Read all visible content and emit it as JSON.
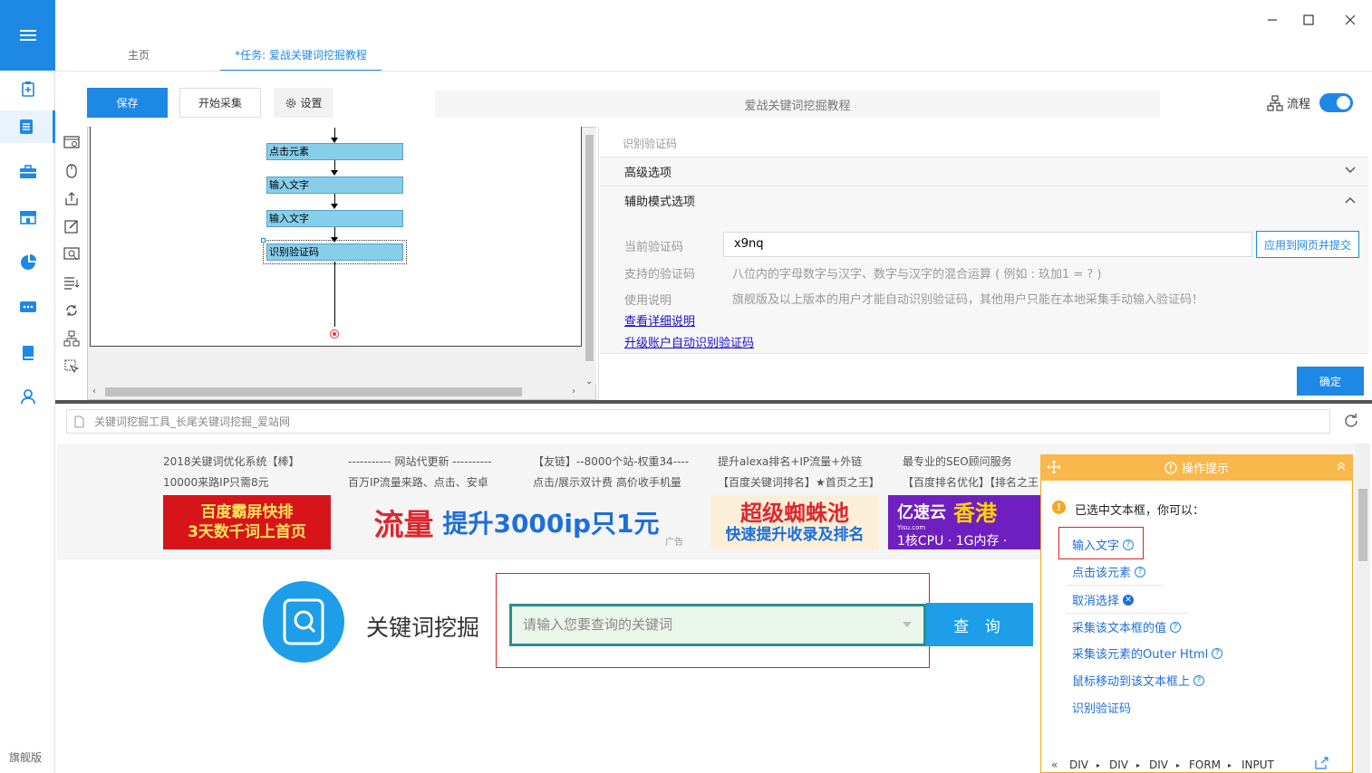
{
  "sidebar": {
    "edition": "旗舰版"
  },
  "tabs": {
    "home": "主页",
    "task": "*任务: 爱战关键词挖掘教程"
  },
  "toolbar": {
    "save": "保存",
    "start": "开始采集",
    "settings": "设置",
    "task_title": "爱战关键词挖掘教程",
    "flow": "流程"
  },
  "workflow": {
    "nodes": [
      "点击元素",
      "输入文字",
      "输入文字",
      "识别验证码"
    ]
  },
  "panel": {
    "title": "识别验证码",
    "advanced": "高级选项",
    "assist": "辅助模式选项",
    "current_label": "当前验证码",
    "current_value": "x9nq",
    "apply_button": "应用到网页并提交",
    "supported_label": "支持的验证码",
    "supported_value": "八位内的字母数字与汉字、数字与汉字的混合运算 ( 例如 : 玖加1 = ? )",
    "usage_label": "使用说明",
    "usage_value": "旗舰版及以上版本的用户才能自动识别验证码，其他用户只能在本地采集手动输入验证码！",
    "link_detail": "查看详细说明",
    "link_upgrade": "升级账户自动识别验证码",
    "ok": "确定"
  },
  "browser": {
    "url": "关键词挖掘工具_长尾关键词挖掘_爱站网"
  },
  "ads": {
    "row1": [
      "2018关键词优化系统【棒】",
      "----------- 网站代更新 ----------",
      "【友链】--8000个站-权重34----",
      "提升alexa排名+IP流量+外链",
      "最专业的SEO顾问服务"
    ],
    "row2": [
      "10000来路IP只需8元",
      "百万IP流量来路、点击、安卓",
      "点击/展示双计费 高价收手机量",
      "【百度关键词排名】★首页之王】",
      "【百度排名优化】【排名之王"
    ],
    "banner1_line1": "百度霸屏快排",
    "banner1_line2": "3天数千词上首页",
    "banner2_a": "流量",
    "banner2_b": "提升3000ip只1元",
    "banner2_tag": "广告",
    "banner3_line1": "超级蜘蛛池",
    "banner3_line2": "快速提升收录及排名",
    "banner4_brand": "亿速云",
    "banner4_brand_sub": "Yisu.com",
    "banner4_region": "香港",
    "banner4_spec": "1核CPU · 1G内存 ·"
  },
  "site": {
    "title": "关键词挖掘",
    "search_placeholder": "请输入您要查询的关键词",
    "query": "查 询"
  },
  "tips": {
    "header": "操作提示",
    "intro": "已选中文本框，你可以：",
    "actions": [
      "输入文字",
      "点击该元素",
      "取消选择",
      "采集该文本框的值",
      "采集该元素的Outer Html",
      "鼠标移动到该文本框上",
      "识别验证码"
    ],
    "breadcrumb": [
      "DIV",
      "DIV",
      "DIV",
      "FORM",
      "INPUT"
    ]
  },
  "colors": {
    "accent": "#1e88e5",
    "tips_header": "#f9b84b",
    "node_fill": "#87ceeb"
  }
}
